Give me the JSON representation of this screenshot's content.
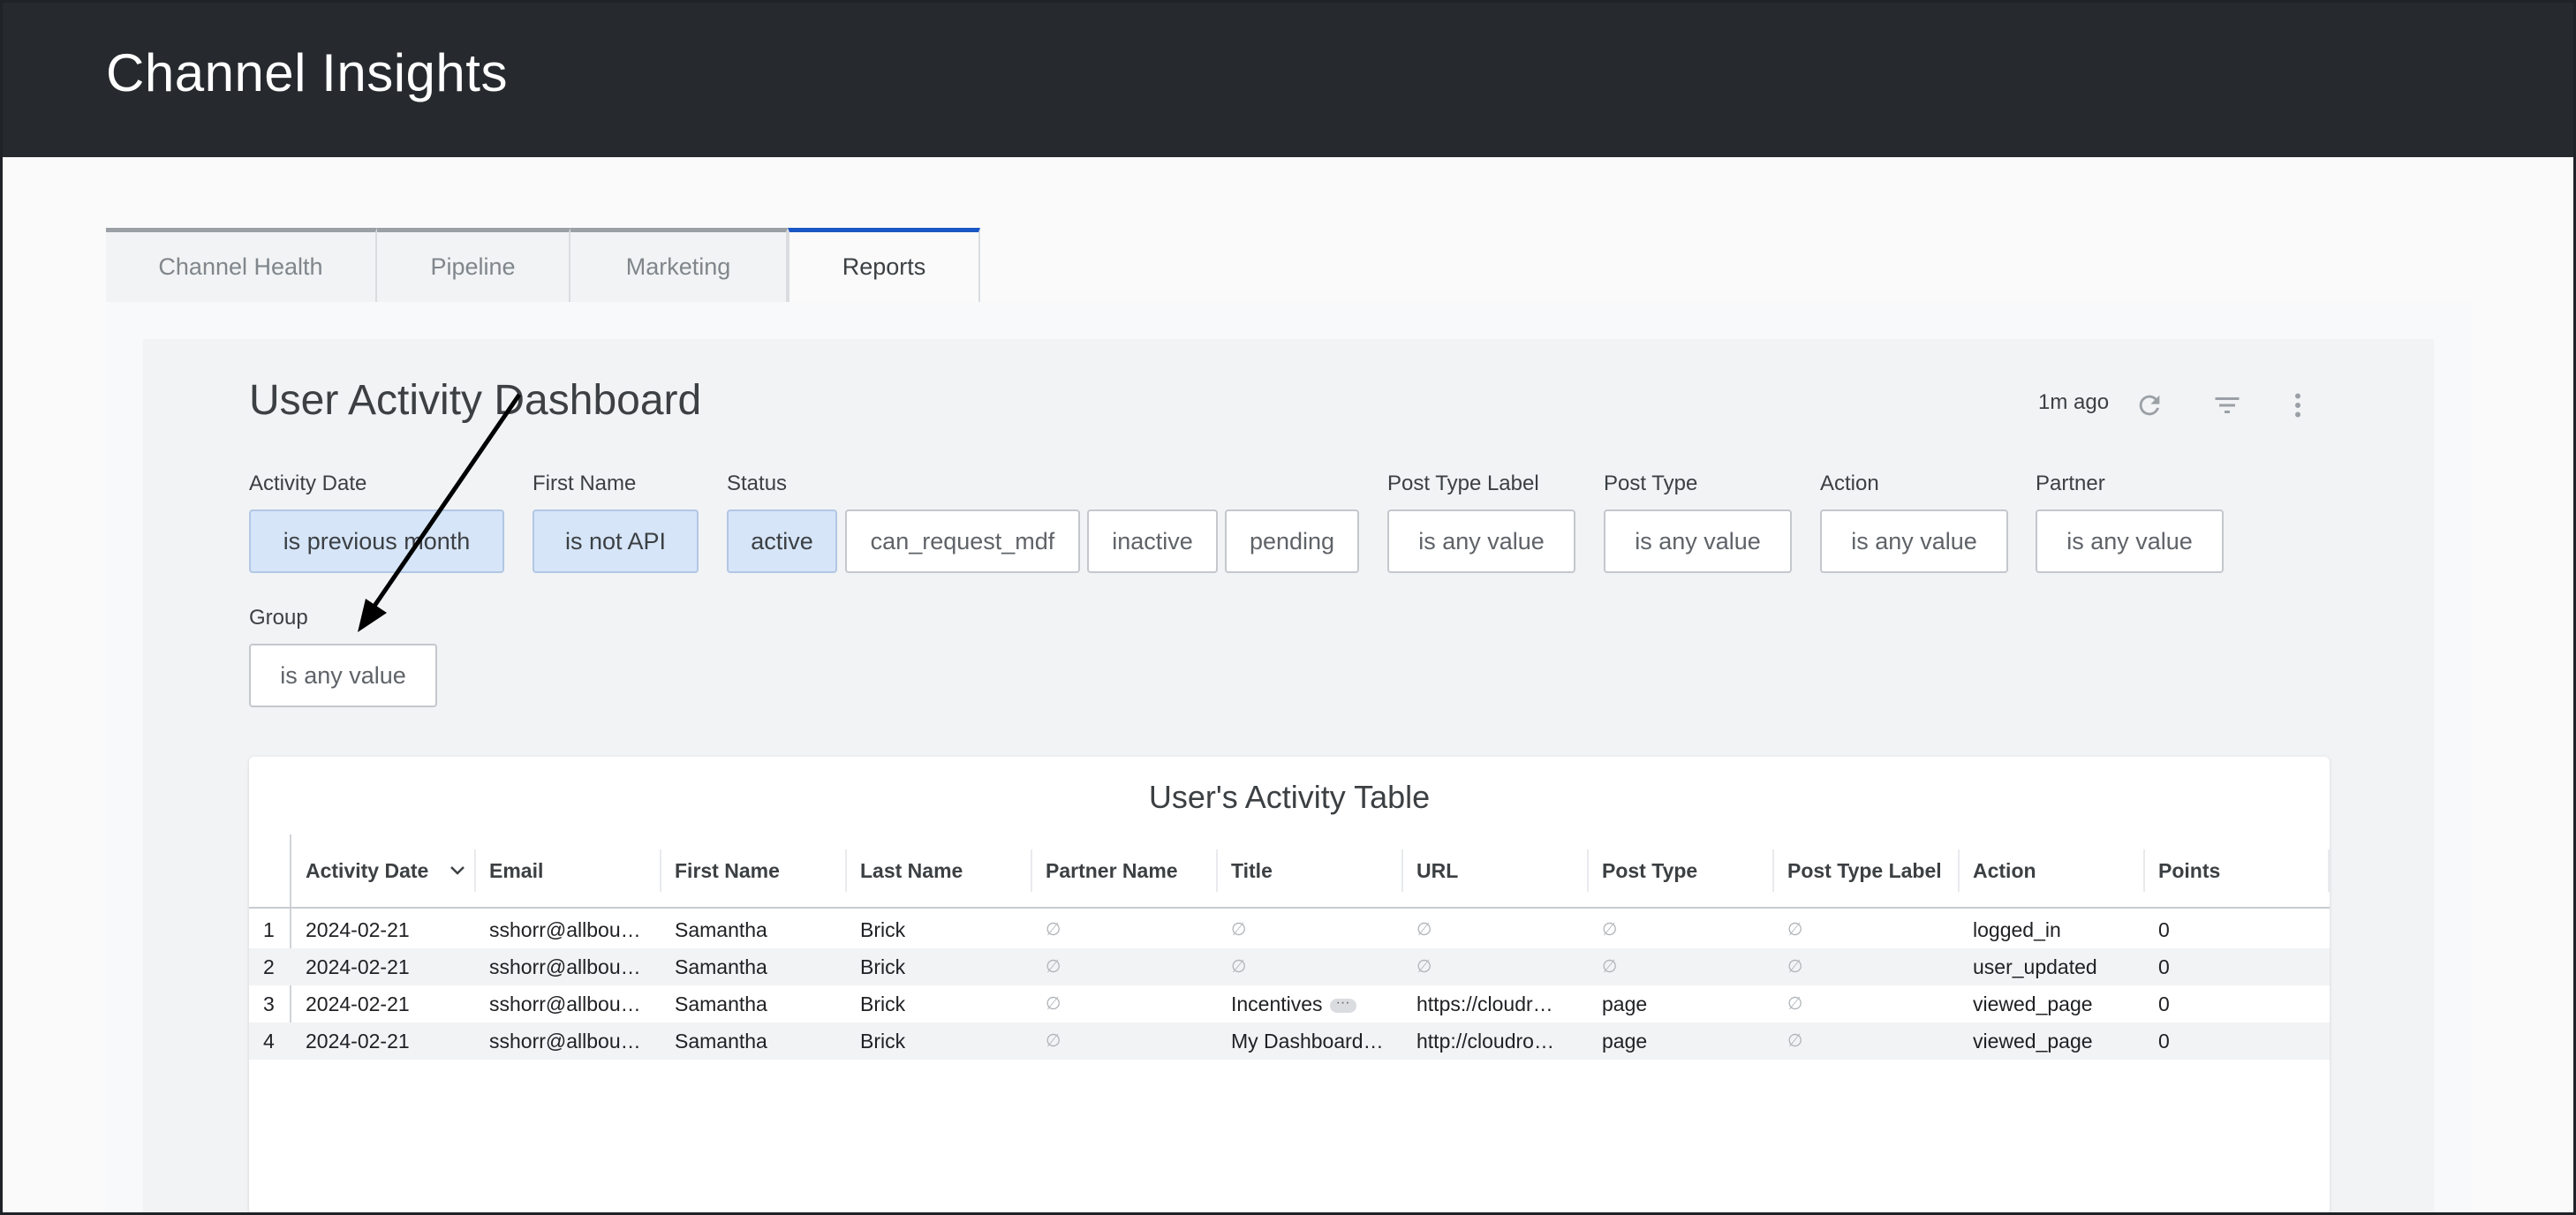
{
  "app": {
    "title": "Channel Insights"
  },
  "tabs": [
    {
      "label": "Channel Health",
      "active": false
    },
    {
      "label": "Pipeline",
      "active": false
    },
    {
      "label": "Marketing",
      "active": false
    },
    {
      "label": "Reports",
      "active": true
    }
  ],
  "dashboard": {
    "title": "User Activity Dashboard",
    "updated": "1m ago",
    "icons": [
      "refresh-icon",
      "filter-icon",
      "more-vert-icon"
    ]
  },
  "filters": {
    "activity_date": {
      "label": "Activity Date",
      "value": "is previous month"
    },
    "first_name": {
      "label": "First Name",
      "value": "is not API"
    },
    "status": {
      "label": "Status",
      "options": [
        "active",
        "can_request_mdf",
        "inactive",
        "pending"
      ],
      "selected": "active"
    },
    "post_type_label": {
      "label": "Post Type Label",
      "value": "is any value"
    },
    "post_type": {
      "label": "Post Type",
      "value": "is any value"
    },
    "action": {
      "label": "Action",
      "value": "is any value"
    },
    "partner": {
      "label": "Partner",
      "value": "is any value"
    },
    "group": {
      "label": "Group",
      "value": "is any value"
    }
  },
  "table": {
    "title": "User's Activity Table",
    "sorted_column": "Activity Date",
    "columns": [
      "Activity Date",
      "Email",
      "First Name",
      "Last Name",
      "Partner Name",
      "Title",
      "URL",
      "Post Type",
      "Post Type Label",
      "Action",
      "Points"
    ],
    "rows": [
      {
        "n": "1",
        "date": "2024-02-21",
        "email": "sshorr@allbou…",
        "first": "Samantha",
        "last": "Brick",
        "partner": "∅",
        "title": "∅",
        "url": "∅",
        "post_type": "∅",
        "post_type_label": "∅",
        "action": "logged_in",
        "points": "0"
      },
      {
        "n": "2",
        "date": "2024-02-21",
        "email": "sshorr@allbou…",
        "first": "Samantha",
        "last": "Brick",
        "partner": "∅",
        "title": "∅",
        "url": "∅",
        "post_type": "∅",
        "post_type_label": "∅",
        "action": "user_updated",
        "points": "0"
      },
      {
        "n": "3",
        "date": "2024-02-21",
        "email": "sshorr@allbou…",
        "first": "Samantha",
        "last": "Brick",
        "partner": "∅",
        "title": "Incentives",
        "url": "https://cloudr…",
        "post_type": "page",
        "post_type_label": "∅",
        "action": "viewed_page",
        "points": "0"
      },
      {
        "n": "4",
        "date": "2024-02-21",
        "email": "sshorr@allbou…",
        "first": "Samantha",
        "last": "Brick",
        "partner": "∅",
        "title": "My Dashboard…",
        "url": "http://cloudro…",
        "post_type": "page",
        "post_type_label": "∅",
        "action": "viewed_page",
        "points": "0"
      }
    ]
  },
  "annotation": {
    "type": "arrow",
    "color": "#000000"
  }
}
